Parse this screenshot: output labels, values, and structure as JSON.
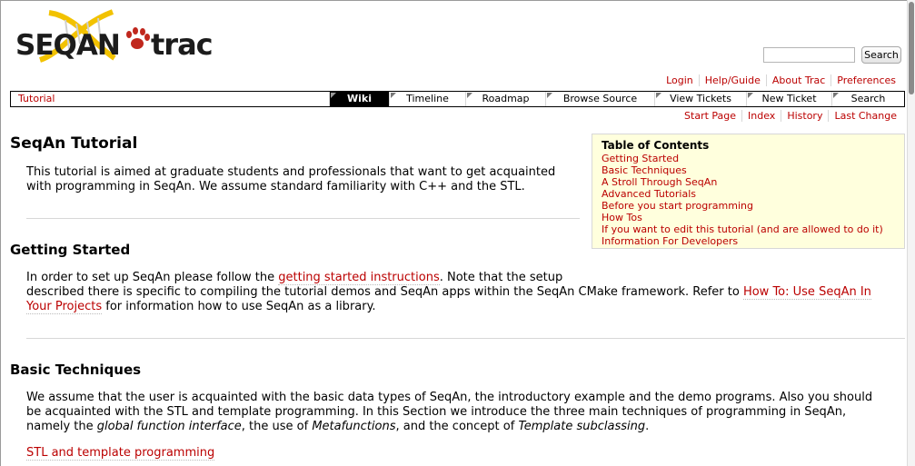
{
  "logo": {
    "left_text": "SEQAN",
    "right_text": "trac"
  },
  "search": {
    "value": "",
    "button_label": "Search"
  },
  "metanav": [
    "Login",
    "Help/Guide",
    "About Trac",
    "Preferences"
  ],
  "mainnav": [
    "Tutorial",
    "Wiki",
    "Timeline",
    "Roadmap",
    "Browse Source",
    "View Tickets",
    "New Ticket",
    "Search"
  ],
  "ctxtnav": [
    "Start Page",
    "Index",
    "History",
    "Last Change"
  ],
  "page": {
    "title": "SeqAn Tutorial",
    "intro_line1": "This tutorial is aimed at graduate students and professionals that want to get acquainted",
    "intro_line2": "with programming in SeqAn. We assume standard familiarity with C++ and the STL.",
    "section1": {
      "heading": "Getting Started",
      "p_a": "In order to set up SeqAn please follow the ",
      "link1": "getting started instructions",
      "p_b": ". Note that the setup",
      "p_c": "described there is specific to compiling the tutorial demos and SeqAn apps within the SeqAn CMake framework. Refer to ",
      "link2a": "How To: Use SeqAn In",
      "link2b": "Your Projects",
      "p_d": " for information how to use SeqAn as a library."
    },
    "section2": {
      "heading": "Basic Techniques",
      "line1": "We assume that the user is acquainted with the basic data types of SeqAn, the introductory example and the demo programs. Also you should",
      "line2": "be acquainted with the STL and template programming. In this Section we introduce the three main techniques of programming in SeqAn,",
      "line3_a": "namely the ",
      "line3_em1": "global function interface",
      "line3_b": ", the use of ",
      "line3_em2": "Metafunctions",
      "line3_c": ", and the concept of ",
      "line3_em3": "Template subclassing",
      "line3_d": ".",
      "link": "STL and template programming"
    }
  },
  "toc": {
    "title": "Table of Contents",
    "items": [
      "Getting Started",
      "Basic Techniques",
      "A Stroll Through SeqAn",
      "Advanced Tutorials",
      "Before you start programming",
      "How Tos",
      "If you want to edit this tutorial (and are allowed to do it)",
      "Information For Developers"
    ]
  },
  "colors": {
    "link": "#bb0000",
    "toc_bg": "#ffffdd",
    "active_tab": "#000000",
    "logo_yellow": "#f2c200"
  }
}
